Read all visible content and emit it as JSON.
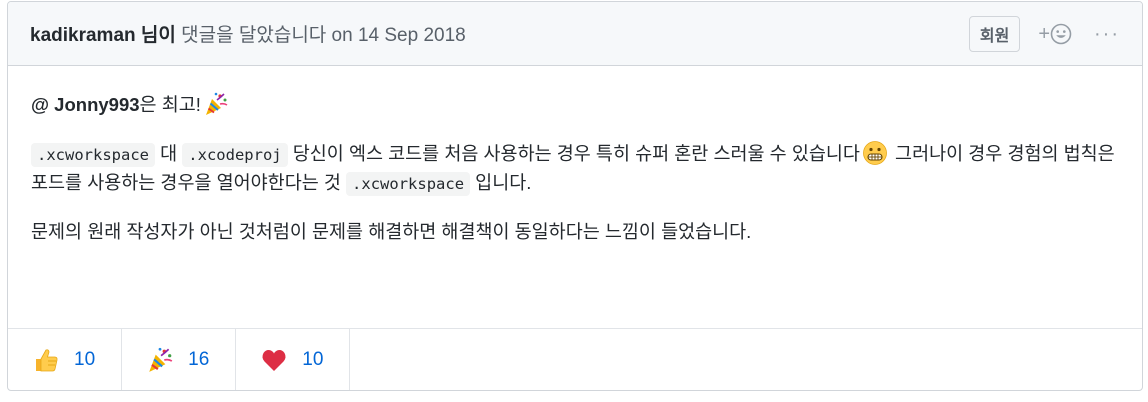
{
  "header": {
    "author": "kadikraman",
    "nim_i": " 님이",
    "action": " 댓글을 달았습니다 on 14 Sep 2018",
    "member_badge": "회원",
    "add_reaction_plus": "+",
    "more": "···"
  },
  "body": {
    "p1": {
      "mention": "@ Jonny993",
      "text": "은 최고!",
      "emoji": "party-popper-icon"
    },
    "p2": {
      "code1": ".xcworkspace",
      "text1": " 대 ",
      "code2": ".xcodeproj",
      "text2": " 당신이 엑스 코드를 처음 사용하는 경우 특히 슈퍼 혼란 스러울 수 있습니다",
      "emoji": "grimacing-face-icon",
      "text3": "  그러나이 경우 경험의 법칙은 포드를 사용하는 경우을 열어야한다는 것 ",
      "code3": ".xcworkspace",
      "text4": " 입니다."
    },
    "p3": "문제의 원래 작성자가 아닌 것처럼이 문제를 해결하면 해결책이 동일하다는 느낌이 들었습니다."
  },
  "reactions": [
    {
      "icon": "thumbs-up-icon",
      "count": "10"
    },
    {
      "icon": "party-popper-icon",
      "count": "16"
    },
    {
      "icon": "heart-icon",
      "count": "10"
    }
  ],
  "colors": {
    "link": "#0366d6",
    "header_bg": "#f6f8fa",
    "border": "#d1d5da"
  }
}
